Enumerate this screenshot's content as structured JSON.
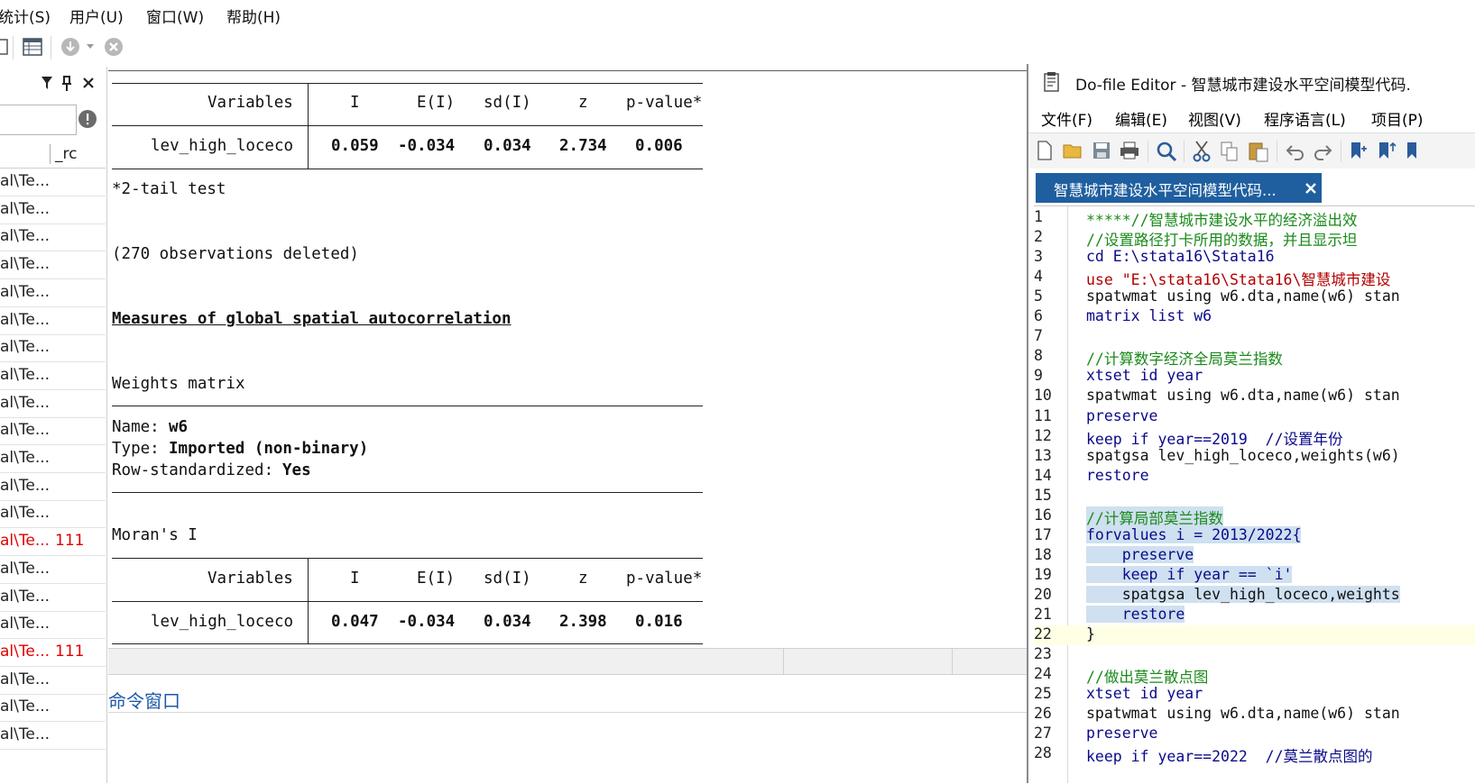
{
  "menubar": {
    "items": [
      "统计(S)",
      "用户(U)",
      "窗口(W)",
      "帮助(H)"
    ],
    "first_label_visible": "统计(S)"
  },
  "leftpanel": {
    "col_header": "_rc",
    "rows": [
      {
        "text": "al\\Te...",
        "rc": ""
      },
      {
        "text": "al\\Te...",
        "rc": ""
      },
      {
        "text": "al\\Te...",
        "rc": ""
      },
      {
        "text": "al\\Te...",
        "rc": ""
      },
      {
        "text": "al\\Te...",
        "rc": ""
      },
      {
        "text": "al\\Te...",
        "rc": ""
      },
      {
        "text": "al\\Te...",
        "rc": ""
      },
      {
        "text": "al\\Te...",
        "rc": ""
      },
      {
        "text": "al\\Te...",
        "rc": ""
      },
      {
        "text": "al\\Te...",
        "rc": ""
      },
      {
        "text": "al\\Te...",
        "rc": ""
      },
      {
        "text": "al\\Te...",
        "rc": ""
      },
      {
        "text": "al\\Te...",
        "rc": ""
      },
      {
        "text": "al\\Te...",
        "rc": "111",
        "error": true
      },
      {
        "text": "al\\Te...",
        "rc": ""
      },
      {
        "text": "al\\Te...",
        "rc": ""
      },
      {
        "text": "al\\Te...",
        "rc": ""
      },
      {
        "text": "al\\Te...",
        "rc": "111",
        "error": true
      },
      {
        "text": "al\\Te...",
        "rc": ""
      },
      {
        "text": "al\\Te...",
        "rc": ""
      },
      {
        "text": "al\\Te...",
        "rc": ""
      }
    ]
  },
  "results": {
    "table1": {
      "headers": [
        "Variables",
        "I",
        "E(I)",
        "sd(I)",
        "z",
        "p-value*"
      ],
      "row": [
        "lev_high_loceco",
        "0.059",
        "-0.034",
        "0.034",
        "2.734",
        "0.006"
      ]
    },
    "tail_note": "*2-tail test",
    "obs_deleted": "(270 observations deleted)",
    "section_title": "Measures of global spatial autocorrelation",
    "weights_title": "Weights matrix",
    "name_label": "Name:",
    "name_value": "w6",
    "type_label": "Type:",
    "type_value": "Imported (non-binary)",
    "rowstd_label": "Row-standardized:",
    "rowstd_value": "Yes",
    "morans_title": "Moran's I",
    "table2": {
      "headers": [
        "Variables",
        "I",
        "E(I)",
        "sd(I)",
        "z",
        "p-value*"
      ],
      "row": [
        "lev_high_loceco",
        "0.047",
        "-0.034",
        "0.034",
        "2.398",
        "0.016"
      ]
    }
  },
  "command_window": {
    "title": "命令窗口"
  },
  "editor": {
    "title": "Do-file Editor - 智慧城市建设水平空间模型代码.",
    "menu": [
      "文件(F)",
      "编辑(E)",
      "视图(V)",
      "程序语言(L)",
      "项目(P)"
    ],
    "tab_label": "智慧城市建设水平空间模型代码...",
    "lines": [
      {
        "n": "1",
        "text": "*****//智慧城市建设水平的经济溢出效"
      },
      {
        "n": "2",
        "text": "//设置路径打卡所用的数据，并且显示坦"
      },
      {
        "n": "3",
        "text": "cd E:\\stata16\\Stata16"
      },
      {
        "n": "4",
        "text": "use \"E:\\stata16\\Stata16\\智慧城市建设"
      },
      {
        "n": "5",
        "text": "spatwmat using w6.dta,name(w6) stan"
      },
      {
        "n": "6",
        "text": "matrix list w6"
      },
      {
        "n": "7",
        "text": ""
      },
      {
        "n": "8",
        "text": "//计算数字经济全局莫兰指数"
      },
      {
        "n": "9",
        "text": "xtset id year"
      },
      {
        "n": "10",
        "text": "spatwmat using w6.dta,name(w6) stan"
      },
      {
        "n": "11",
        "text": "preserve"
      },
      {
        "n": "12",
        "text": "keep if year==2019  //设置年份"
      },
      {
        "n": "13",
        "text": "spatgsa lev_high_loceco,weights(w6)"
      },
      {
        "n": "14",
        "text": "restore"
      },
      {
        "n": "15",
        "text": ""
      },
      {
        "n": "16",
        "text": "//计算局部莫兰指数"
      },
      {
        "n": "17",
        "text": "forvalues i = 2013/2022{"
      },
      {
        "n": "18",
        "text": "    preserve"
      },
      {
        "n": "19",
        "text": "    keep if year == `i'"
      },
      {
        "n": "20",
        "text": "    spatgsa lev_high_loceco,weights"
      },
      {
        "n": "21",
        "text": "    restore"
      },
      {
        "n": "22",
        "text": "}"
      },
      {
        "n": "23",
        "text": ""
      },
      {
        "n": "24",
        "text": "//做出莫兰散点图"
      },
      {
        "n": "25",
        "text": "xtset id year"
      },
      {
        "n": "26",
        "text": "spatwmat using w6.dta,name(w6) stan"
      },
      {
        "n": "27",
        "text": "preserve"
      },
      {
        "n": "28",
        "text": "keep if year==2022  //莫兰散点图的"
      }
    ]
  },
  "colors": {
    "tab_bg": "#1f5f9f",
    "error_red": "#e00000",
    "cmd_title": "#1e5aa8",
    "selection": "#cfe0f0"
  }
}
